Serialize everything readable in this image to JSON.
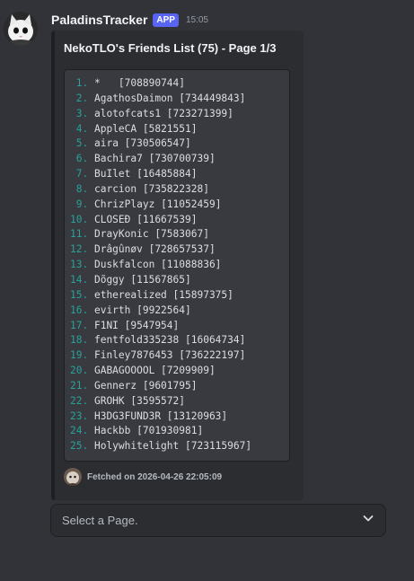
{
  "message": {
    "username": "PaladinsTracker",
    "badge": "APP",
    "timestamp": "15:05"
  },
  "embed": {
    "title": "NekoTLO's Friends List (75) - Page 1/3",
    "entries": [
      {
        "num": "1.",
        "text": "*   [708890744]"
      },
      {
        "num": "2.",
        "text": "AgathosDaimon [734449843]"
      },
      {
        "num": "3.",
        "text": "alotofcats1 [723271399]"
      },
      {
        "num": "4.",
        "text": "AppleCA [5821551]"
      },
      {
        "num": "5.",
        "text": "aira [730506547]"
      },
      {
        "num": "6.",
        "text": "Bachira7 [730700739]"
      },
      {
        "num": "7.",
        "text": "BuIlet [16485884]"
      },
      {
        "num": "8.",
        "text": "carcion [735822328]"
      },
      {
        "num": "9.",
        "text": "ChrizPlayz [11052459]"
      },
      {
        "num": "10.",
        "text": "CLOSEÐ [11667539]"
      },
      {
        "num": "11.",
        "text": "DrayKonic [7583067]"
      },
      {
        "num": "12.",
        "text": "Drâgûnøv [728657537]"
      },
      {
        "num": "13.",
        "text": "Duskfalcon [11088836]"
      },
      {
        "num": "14.",
        "text": "Dõggy [11567865]"
      },
      {
        "num": "15.",
        "text": "etherealized [15897375]"
      },
      {
        "num": "16.",
        "text": "evirth [9922564]"
      },
      {
        "num": "17.",
        "text": "F1NI [9547954]"
      },
      {
        "num": "18.",
        "text": "fentfold335238 [16064734]"
      },
      {
        "num": "19.",
        "text": "Finley7876453 [736222197]"
      },
      {
        "num": "20.",
        "text": "GABAGOOOOL [7209909]"
      },
      {
        "num": "21.",
        "text": "Gennerz [9601795]"
      },
      {
        "num": "22.",
        "text": "GROHK [3595572]"
      },
      {
        "num": "23.",
        "text": "H3DG3FUND3R [13120963]"
      },
      {
        "num": "24.",
        "text": "Hackbb [701930981]"
      },
      {
        "num": "25.",
        "text": "Holywhitelight [723115967]"
      }
    ],
    "footer": "Fetched on 2026-04-26 22:05:09"
  },
  "select": {
    "placeholder": "Select a Page."
  },
  "colors": {
    "background": "#313338",
    "embed_bg": "#2b2d31",
    "code_bg": "#383a40",
    "line_number": "#2aa198",
    "app_badge": "#5865f2"
  },
  "icons": {
    "avatar": "cat-avatar",
    "footer": "cat-avatar-small",
    "select_arrow": "chevron-down-icon"
  }
}
